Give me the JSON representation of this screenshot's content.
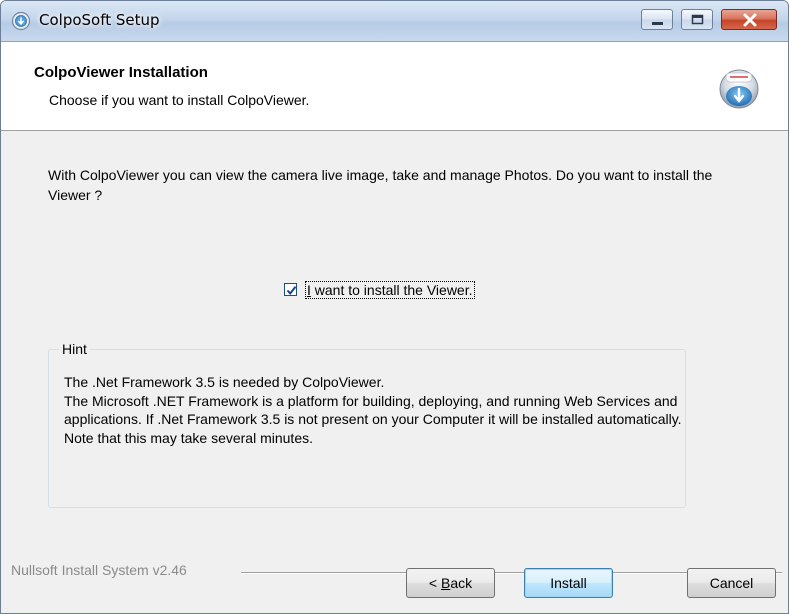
{
  "window": {
    "title": "ColpoSoft Setup",
    "controls": {
      "minimize": "minimize",
      "maximize": "maximize",
      "close": "close"
    }
  },
  "header": {
    "title": "ColpoViewer Installation",
    "subtitle": "Choose if you want to install ColpoViewer."
  },
  "main": {
    "description": "With ColpoViewer you can view the camera live image, take and manage Photos. Do you want to install the Viewer ?",
    "checkbox": {
      "label_mnemonic": "I",
      "label_rest": " want to install the Viewer.",
      "checked": true
    }
  },
  "hint": {
    "title": "Hint",
    "lines": [
      "The .Net Framework 3.5 is needed by ColpoViewer.",
      "The Microsoft .NET Framework is a platform for building, deploying, and running Web Services and applications. If .Net Framework 3.5 is not present on your Computer it will be installed automatically. Note that this may take several minutes."
    ]
  },
  "footer": {
    "branding": "Nullsoft Install System v2.46",
    "buttons": {
      "back_prefix": "< ",
      "back_mnemonic": "B",
      "back_rest": "ack",
      "install": "Install",
      "cancel": "Cancel"
    }
  },
  "colors": {
    "dialog_bg": "#f0f0f0",
    "header_bg": "#ffffff",
    "default_button_border": "#3c7fb1",
    "close_button": "#c6442a"
  },
  "icons": {
    "title": "setup-app-icon",
    "header": "install-download-icon",
    "checkbox": "checkmark-icon"
  }
}
